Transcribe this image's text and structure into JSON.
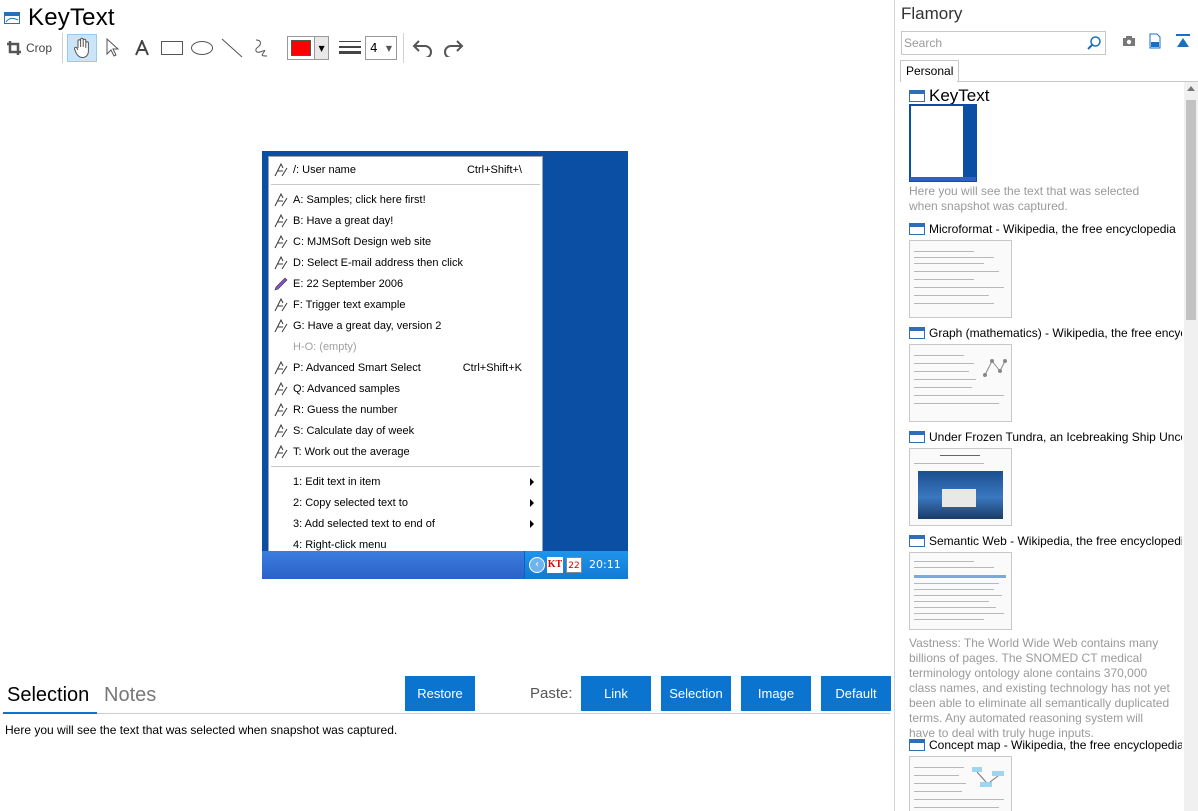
{
  "app": {
    "document_title": "KeyText"
  },
  "toolbar": {
    "crop_label": "Crop",
    "stroke_width_value": "4",
    "stroke_color": "#ff0000",
    "tools": [
      "hand-icon",
      "pointer-icon",
      "text-icon",
      "rectangle-icon",
      "ellipse-icon",
      "line-icon",
      "freehand-icon",
      "line-width-icon",
      "undo-icon",
      "redo-icon"
    ]
  },
  "screenshot": {
    "menu": {
      "items": [
        {
          "label": "/:  User name",
          "shortcut": "Ctrl+Shift+\\"
        },
        {
          "label": "A:  Samples; click here first!",
          "shortcut": ""
        },
        {
          "label": "B:  Have a great day!",
          "shortcut": ""
        },
        {
          "label": "C:  MJMSoft Design web site",
          "shortcut": ""
        },
        {
          "label": "D:  Select E-mail address then click",
          "shortcut": ""
        },
        {
          "label": "E:  22 September 2006",
          "shortcut": ""
        },
        {
          "label": "F:  Trigger text example",
          "shortcut": ""
        },
        {
          "label": "G:  Have a great day, version 2",
          "shortcut": ""
        },
        {
          "label": "H-O: (empty)",
          "shortcut": ""
        },
        {
          "label": "P:  Advanced Smart Select",
          "shortcut": "Ctrl+Shift+K"
        },
        {
          "label": "Q:  Advanced samples",
          "shortcut": ""
        },
        {
          "label": "R:  Guess the number",
          "shortcut": ""
        },
        {
          "label": "S:  Calculate day of week",
          "shortcut": ""
        },
        {
          "label": "T:  Work out the average",
          "shortcut": ""
        },
        {
          "label": "1:  Edit text in item",
          "shortcut": ""
        },
        {
          "label": "2:  Copy selected text to",
          "shortcut": ""
        },
        {
          "label": "3:  Add selected text to end of",
          "shortcut": ""
        },
        {
          "label": "4:  Right-click menu",
          "shortcut": ""
        }
      ]
    },
    "tray": {
      "kt_label": "KT",
      "calendar_label": "22",
      "time": "20:11"
    }
  },
  "bottom": {
    "tabs": [
      "Selection",
      "Notes"
    ],
    "restore_label": "Restore",
    "paste_label": "Paste:",
    "paste_buttons": [
      "Link",
      "Selection",
      "Image",
      "Default"
    ],
    "selection_text": "Here you will see the text that was selected when snapshot was captured."
  },
  "flamory": {
    "title": "Flamory",
    "search_placeholder": "Search",
    "tab_personal": "Personal",
    "items": [
      {
        "title": "KeyText",
        "description": "Here you will see the text that was selected when snapshot was captured."
      },
      {
        "title": "Microformat - Wikipedia, the free encyclopedia",
        "description": ""
      },
      {
        "title": "Graph (mathematics) - Wikipedia, the free encyclopedia",
        "description": ""
      },
      {
        "title": "Under Frozen Tundra, an Icebreaking Ship Uncovers",
        "description": ""
      },
      {
        "title": "Semantic Web - Wikipedia, the free encyclopedia",
        "description": "Vastness: The World Wide Web contains many billions of pages. The SNOMED CT medical terminology ontology alone contains 370,000 class names, and existing technology has not yet been able to eliminate all semantically duplicated terms. Any automated reasoning system will have to deal with truly huge inputs."
      },
      {
        "title": "Concept map - Wikipedia, the free encyclopedia",
        "description": ""
      }
    ]
  }
}
